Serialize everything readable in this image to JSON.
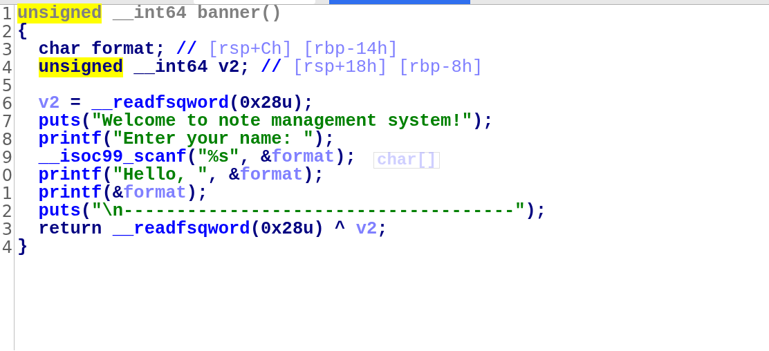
{
  "tabs": [
    {
      "selected": false
    },
    {
      "selected": true
    }
  ],
  "tooltip": {
    "text": "char[]"
  },
  "lines": [
    {
      "number": "1",
      "tokens": [
        {
          "text": "unsigned",
          "kind": "header_hl"
        },
        {
          "text": " __int64 banner()",
          "kind": "header"
        }
      ]
    },
    {
      "number": "2",
      "tokens": [
        {
          "text": "{",
          "kind": "plain"
        }
      ]
    },
    {
      "number": "3",
      "tokens": [
        {
          "text": "  char format; ",
          "kind": "plain"
        },
        {
          "text": "// ",
          "kind": "comment"
        },
        {
          "text": "[rsp+Ch] [rbp-14h]",
          "kind": "ref"
        }
      ]
    },
    {
      "number": "4",
      "tokens": [
        {
          "text": "  unsigned",
          "kind": "plain_hl"
        },
        {
          "text": " __int64 v2; ",
          "kind": "plain"
        },
        {
          "text": "// ",
          "kind": "comment"
        },
        {
          "text": "[rsp+18h] [rbp-8h]",
          "kind": "ref"
        }
      ]
    },
    {
      "number": "5"
    },
    {
      "number": "6",
      "tokens": [
        {
          "text": "  v2",
          "kind": "var"
        },
        {
          "text": " = ",
          "kind": "plain"
        },
        {
          "text": "__readfsqword",
          "kind": "func"
        },
        {
          "text": "(0x28u);",
          "kind": "plain"
        }
      ]
    },
    {
      "number": "7",
      "tokens": [
        {
          "text": "  puts",
          "kind": "func"
        },
        {
          "text": "(",
          "kind": "plain"
        },
        {
          "text": "\"Welcome to note management system!\"",
          "kind": "string"
        },
        {
          "text": ");",
          "kind": "plain"
        }
      ]
    },
    {
      "number": "8",
      "tokens": [
        {
          "text": "  printf",
          "kind": "func"
        },
        {
          "text": "(",
          "kind": "plain"
        },
        {
          "text": "\"Enter your name: \"",
          "kind": "string"
        },
        {
          "text": ");",
          "kind": "plain"
        }
      ]
    },
    {
      "number": "9",
      "tokens": [
        {
          "text": "  __isoc99_scanf",
          "kind": "func"
        },
        {
          "text": "(",
          "kind": "plain"
        },
        {
          "text": "\"%s\"",
          "kind": "string"
        },
        {
          "text": ", &",
          "kind": "plain"
        },
        {
          "text": "format",
          "kind": "var"
        },
        {
          "text": ");",
          "kind": "plain"
        }
      ]
    },
    {
      "number": "0",
      "tokens": [
        {
          "text": "  printf",
          "kind": "func"
        },
        {
          "text": "(",
          "kind": "plain"
        },
        {
          "text": "\"Hello, \"",
          "kind": "string"
        },
        {
          "text": ", &",
          "kind": "plain"
        },
        {
          "text": "format",
          "kind": "var"
        },
        {
          "text": ");",
          "kind": "plain"
        }
      ]
    },
    {
      "number": "1",
      "tokens": [
        {
          "text": "  printf",
          "kind": "func"
        },
        {
          "text": "(&",
          "kind": "plain"
        },
        {
          "text": "format",
          "kind": "var"
        },
        {
          "text": ");",
          "kind": "plain"
        }
      ]
    },
    {
      "number": "2",
      "tokens": [
        {
          "text": "  puts",
          "kind": "func"
        },
        {
          "text": "(",
          "kind": "plain"
        },
        {
          "text": "\"\\n-------------------------------------\"",
          "kind": "string"
        },
        {
          "text": ");",
          "kind": "plain"
        }
      ]
    },
    {
      "number": "3",
      "tokens": [
        {
          "text": "  return ",
          "kind": "plain"
        },
        {
          "text": "__readfsqword",
          "kind": "func"
        },
        {
          "text": "(0x28u) ^ ",
          "kind": "plain"
        },
        {
          "text": "v2",
          "kind": "var"
        },
        {
          "text": ";",
          "kind": "plain"
        }
      ]
    },
    {
      "number": "4",
      "tokens": [
        {
          "text": "}",
          "kind": "plain"
        }
      ]
    }
  ]
}
